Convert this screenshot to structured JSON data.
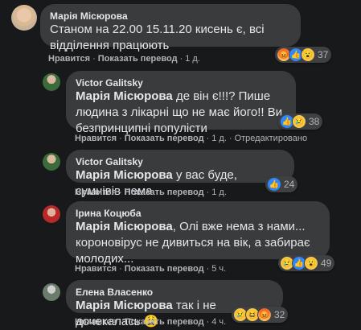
{
  "comments": [
    {
      "author": "Марія Місюрова",
      "mention": "",
      "text": "Станом на 22.00 15.11.20 кисень є, всі відділення працюють",
      "like": "Нравится",
      "translate": "Показать перевод",
      "time": "1 д.",
      "edited": "",
      "reaction_count": "37"
    },
    {
      "author": "Victor Galitsky",
      "mention": "Марія Місюрова",
      "text": "де він є!!!? Пише людина з лікарні що не має його!! Ви безпринципні популісти",
      "like": "Нравится",
      "translate": "Показать перевод",
      "time": "1 д.",
      "edited": "Отредактировано",
      "reaction_count": "38"
    },
    {
      "author": "Victor Galitsky",
      "mention": "Марія Місюрова",
      "text": "у вас буде, сумнівів нема",
      "like": "Нравится",
      "translate": "Показать перевод",
      "time": "1 д.",
      "edited": "",
      "reaction_count": "24"
    },
    {
      "author": "Ірина Коцюба",
      "mention": "Марія Місюрова",
      "text": ", Олі вже нема з нами... короновірус не дивиться на вік, а забирає молодих...",
      "like": "Нравится",
      "translate": "Показать перевод",
      "time": "5 ч.",
      "edited": "",
      "reaction_count": "49"
    },
    {
      "author": "Елена Власенко",
      "mention": "Марія Місюрова",
      "text": "так і не дочекалась 😩",
      "like": "Нравится",
      "translate": "Показать перевод",
      "time": "4 ч.",
      "edited": "",
      "reaction_count": "32"
    }
  ],
  "colors": {
    "background": "#18191a",
    "bubble": "#3a3b3c",
    "text": "#e4e6eb",
    "secondary": "#b0b3b8",
    "like": "#2d88ff"
  }
}
